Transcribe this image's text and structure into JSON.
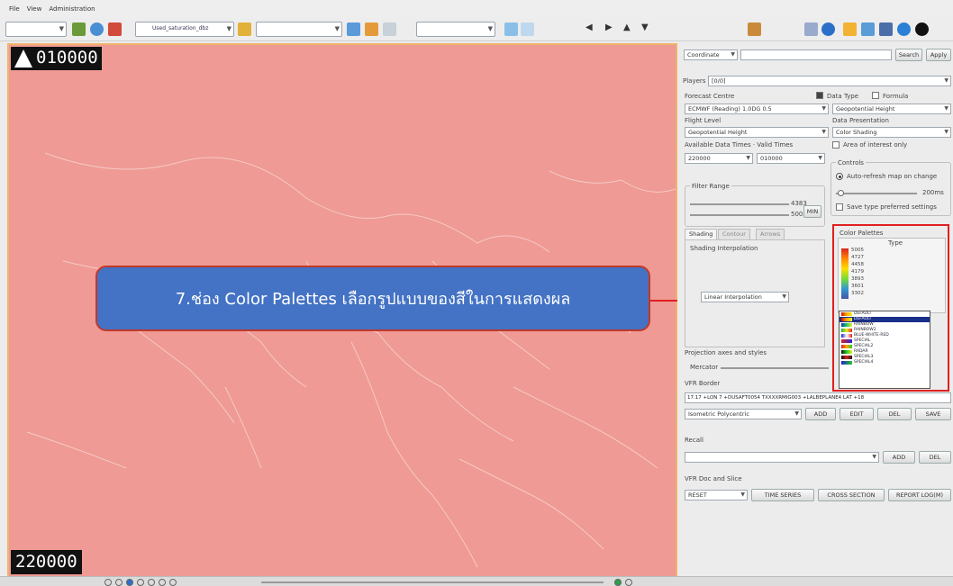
{
  "menu": [
    "File",
    "View",
    "Administration"
  ],
  "toolbar": {
    "product_combo": "Used_saturation_dbz",
    "nav_buttons": [
      "◀",
      "▶",
      "▲",
      "▼"
    ]
  },
  "map": {
    "time_top": "010000",
    "time_bottom": "220000"
  },
  "callout": {
    "text": "7.ช่อง Color Palettes เลือกรูปแบบของสีในการแสดงผล"
  },
  "panel": {
    "coord_combo": "Coordinate",
    "search_btn": "Search",
    "apply_btn": "Apply",
    "players_label": "Players",
    "players_value": "[0/0]",
    "forecast_centre_label": "Forecast Centre",
    "datatype_label": "Data Type",
    "formula_label": "Formula",
    "forecast_centre_value": "ECMWF (Reading) 1.0DG 0.5",
    "datatype_value": "Geopotential Height",
    "flight_level_label": "Flight Level",
    "data_presentation_label": "Data Presentation",
    "flight_level_value": "Geopotential Height",
    "data_presentation_value": "Color Shading",
    "available_times_label": "Available Data Times · Valid Times",
    "area_interest_label": "Area of interest only",
    "time1": "220000",
    "time2": "010000",
    "controls_label": "Controls",
    "auto_refresh_label": "Auto-refresh map on change",
    "slider_ms": "200ms",
    "filter_range_label": "Filter Range",
    "filter_max": "4383",
    "filter_min": "5005",
    "filter_btn": "MIN",
    "save_type_label": "Save type preferred settings",
    "tabs": [
      "Shading",
      "Contour",
      "Arrows"
    ],
    "shading_interp_label": "Shading Interpolation",
    "interp_value": "Linear Interpolation",
    "color_palettes_label": "Color Palettes",
    "type_label": "Type",
    "legend_values": [
      "5005",
      "4727",
      "4458",
      "4179",
      "3893",
      "3601",
      "3302"
    ],
    "palettes": [
      "DEFAULT",
      "DEFAULT",
      "RAINBOW",
      "RAINBOW2",
      "BLUE-WHITE-RED",
      "SPECIAL",
      "SPECIAL2",
      "RADAR",
      "SPECIAL3",
      "SPECIAL4"
    ],
    "projection_label": "Projection axes and styles",
    "projection_value": "Mercator",
    "vfr_label": "VFR Border",
    "vfr_text": "17.17 +LON 7 +DUSAFT0054 TXXXXRMIG003 +LALBEPLANE4 LAT +18",
    "vfr_combo": "Isometric Polycentric",
    "vfr_btns": [
      "ADD",
      "EDIT",
      "DEL",
      "SAVE"
    ],
    "recall_label": "Recall",
    "recall_btns": [
      "ADD",
      "DEL"
    ],
    "vfr_doc_label": "VFR Doc and Slice",
    "vfr_doc_combo": "RESET",
    "doc_btns": [
      "TIME SERIES",
      "CROSS SECTION",
      "REPORT LOG(M)"
    ]
  },
  "colors": {
    "map_fill": "#ef9a94",
    "callout_fill": "#4472c4",
    "highlight": "#e02020"
  }
}
